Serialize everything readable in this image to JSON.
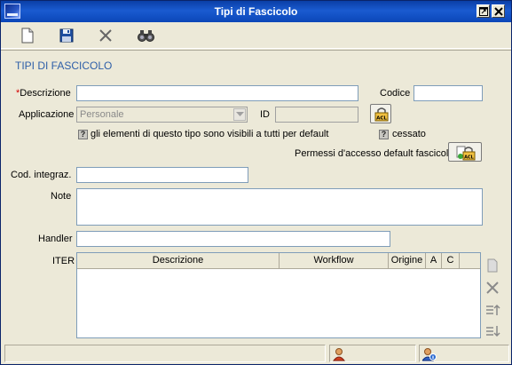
{
  "window": {
    "title": "Tipi di Fascicolo",
    "app_logo_icon": "app-logo-icon",
    "restore_icon": "restore-icon",
    "close_icon": "close-icon"
  },
  "toolbar": {
    "items": [
      {
        "name": "new",
        "icon": "new-document-icon"
      },
      {
        "name": "save",
        "icon": "floppy-disk-icon"
      },
      {
        "name": "cancel",
        "icon": "x-cancel-icon"
      },
      {
        "name": "find",
        "icon": "binoculars-icon"
      }
    ]
  },
  "form": {
    "section_title": "TIPI DI FASCICOLO",
    "required_mark": "*",
    "descrizione_label": "Descrizione",
    "descrizione_value": "",
    "codice_label": "Codice",
    "codice_value": "",
    "applicazione_label": "Applicazione",
    "applicazione_value": "Personale",
    "id_label": "ID",
    "id_value": "",
    "visible_checkbox_mark": "?",
    "visible_label": "gli elementi di questo tipo sono visibili a tutti per default",
    "cessato_checkbox_mark": "?",
    "cessato_label": "cessato",
    "permessi_label": "Permessi d'accesso default fascicoli",
    "acl_icon_text": "ACL",
    "cod_integraz_label": "Cod. integraz.",
    "cod_integraz_value": "",
    "note_label": "Note",
    "note_value": "",
    "handler_label": "Handler",
    "handler_value": ""
  },
  "iter": {
    "label": "ITER",
    "columns": [
      "Descrizione",
      "Workflow",
      "Origine",
      "A",
      "C"
    ],
    "rows": [],
    "side_icons": [
      "new-row-icon",
      "delete-row-icon",
      "move-up-icon",
      "move-down-icon"
    ]
  },
  "statusbar": {
    "panels": [
      {
        "name": "message",
        "text": ""
      },
      {
        "name": "user",
        "icon": "user-icon"
      },
      {
        "name": "user-info",
        "icon": "user-info-icon"
      }
    ]
  },
  "colors": {
    "titlebar": "#0a3fa6",
    "section_title": "#2e5fa8",
    "required": "#d40000",
    "background": "#ece9d8"
  }
}
